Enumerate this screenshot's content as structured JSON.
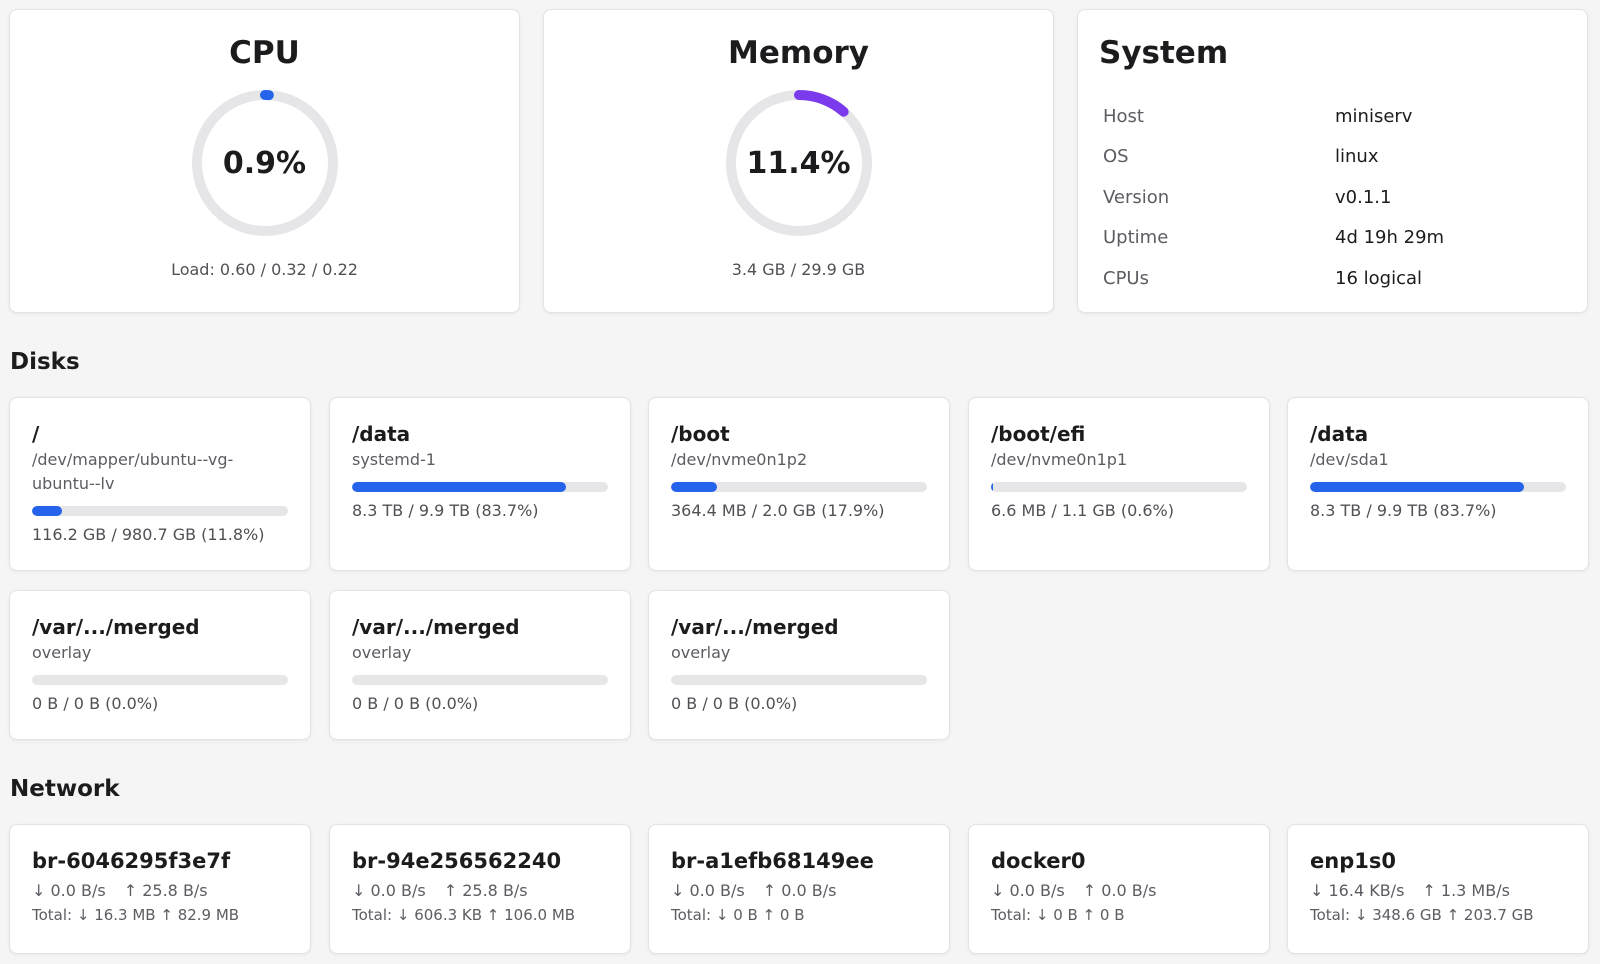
{
  "cpu": {
    "title": "CPU",
    "value_text": "0.9%",
    "percent": 0.9,
    "color": "#2563eb",
    "sub": "Load: 0.60 / 0.32 / 0.22"
  },
  "memory": {
    "title": "Memory",
    "value_text": "11.4%",
    "percent": 11.4,
    "color": "#7c3aed",
    "sub": "3.4 GB / 29.9 GB"
  },
  "system": {
    "title": "System",
    "rows": [
      {
        "key": "Host",
        "value": "miniserv"
      },
      {
        "key": "OS",
        "value": "linux"
      },
      {
        "key": "Version",
        "value": "v0.1.1"
      },
      {
        "key": "Uptime",
        "value": "4d 19h 29m"
      },
      {
        "key": "CPUs",
        "value": "16 logical"
      }
    ]
  },
  "disks": {
    "title": "Disks",
    "bar_color": "#2563eb",
    "items": [
      {
        "mount": "/",
        "device": "/dev/mapper/ubuntu--vg-ubuntu--lv",
        "usage": "116.2 GB / 980.7 GB (11.8%)",
        "percent": 11.8
      },
      {
        "mount": "/data",
        "device": "systemd-1",
        "usage": "8.3 TB / 9.9 TB (83.7%)",
        "percent": 83.7
      },
      {
        "mount": "/boot",
        "device": "/dev/nvme0n1p2",
        "usage": "364.4 MB / 2.0 GB (17.9%)",
        "percent": 17.9
      },
      {
        "mount": "/boot/efi",
        "device": "/dev/nvme0n1p1",
        "usage": "6.6 MB / 1.1 GB (0.6%)",
        "percent": 0.6
      },
      {
        "mount": "/data",
        "device": "/dev/sda1",
        "usage": "8.3 TB / 9.9 TB (83.7%)",
        "percent": 83.7
      },
      {
        "mount": "/var/.../merged",
        "device": "overlay",
        "usage": "0 B / 0 B (0.0%)",
        "percent": 0
      },
      {
        "mount": "/var/.../merged",
        "device": "overlay",
        "usage": "0 B / 0 B (0.0%)",
        "percent": 0
      },
      {
        "mount": "/var/.../merged",
        "device": "overlay",
        "usage": "0 B / 0 B (0.0%)",
        "percent": 0
      }
    ]
  },
  "network": {
    "title": "Network",
    "items": [
      {
        "name": "br-6046295f3e7f",
        "down": "↓ 0.0 B/s",
        "up": "↑ 25.8 B/s",
        "total": "Total: ↓ 16.3 MB ↑ 82.9 MB"
      },
      {
        "name": "br-94e256562240",
        "down": "↓ 0.0 B/s",
        "up": "↑ 25.8 B/s",
        "total": "Total: ↓ 606.3 KB ↑ 106.0 MB"
      },
      {
        "name": "br-a1efb68149ee",
        "down": "↓ 0.0 B/s",
        "up": "↑ 0.0 B/s",
        "total": "Total: ↓ 0 B ↑ 0 B"
      },
      {
        "name": "docker0",
        "down": "↓ 0.0 B/s",
        "up": "↑ 0.0 B/s",
        "total": "Total: ↓ 0 B ↑ 0 B"
      },
      {
        "name": "enp1s0",
        "down": "↓ 16.4 KB/s",
        "up": "↑ 1.3 MB/s",
        "total": "Total: ↓ 348.6 GB ↑ 203.7 GB"
      }
    ]
  }
}
